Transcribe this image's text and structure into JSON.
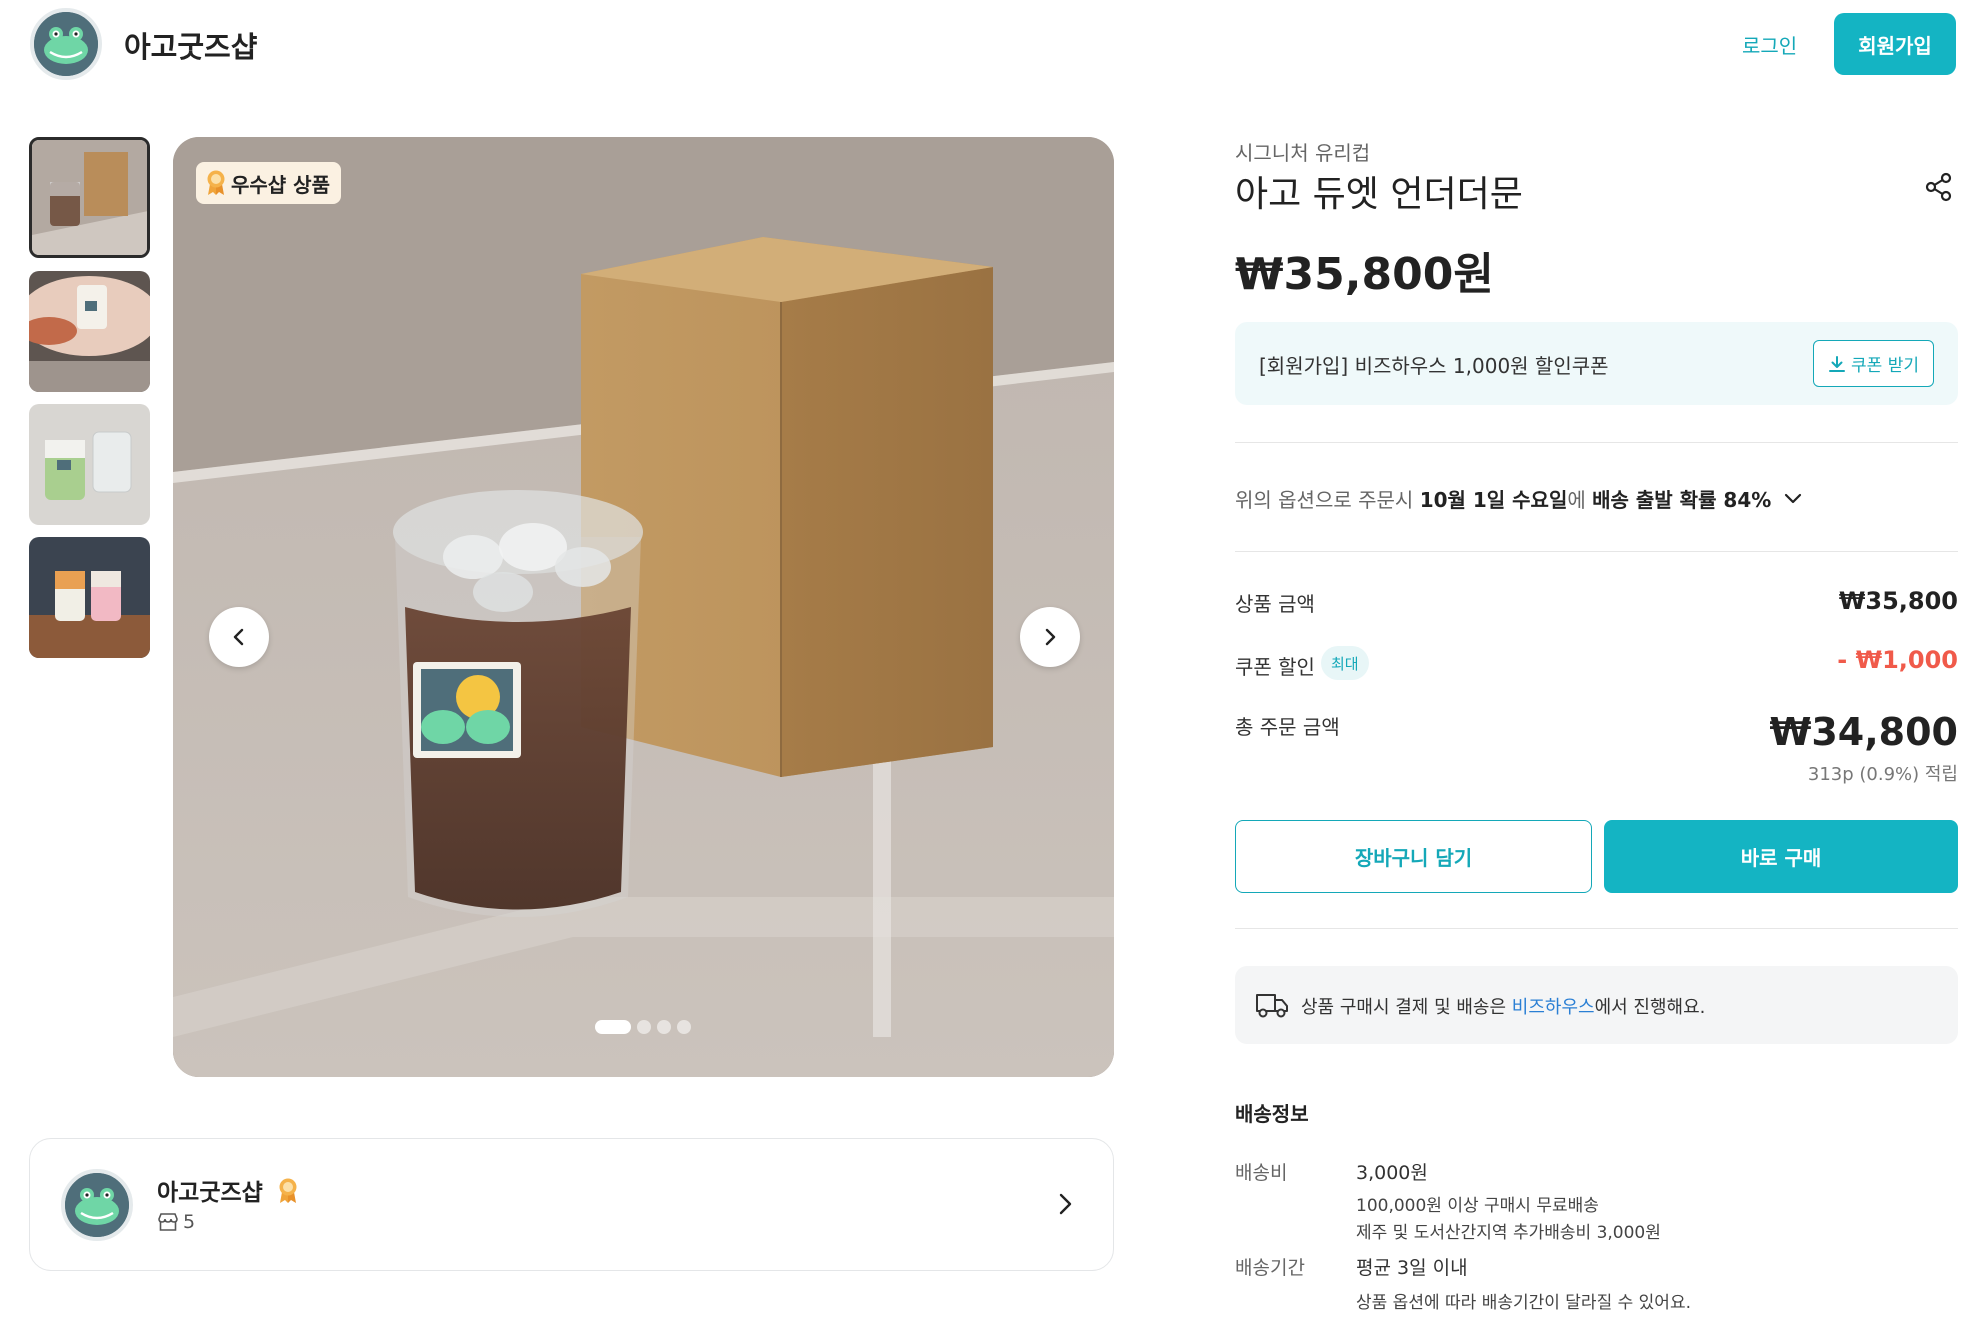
{
  "header": {
    "brand": "아고굿즈샵",
    "login": "로그인",
    "signup": "회원가입"
  },
  "gallery": {
    "thumbnails": [
      {
        "name": "thumb-1",
        "active": true
      },
      {
        "name": "thumb-2",
        "active": false
      },
      {
        "name": "thumb-3",
        "active": false
      },
      {
        "name": "thumb-4",
        "active": false
      }
    ],
    "badge": "우수샵 상품",
    "slide_count": 4,
    "active_slide": 1
  },
  "shop": {
    "name": "아고굿즈샵",
    "product_count": "5"
  },
  "product": {
    "category": "시그니처 유리컵",
    "title": "아고 듀엣 언더더문",
    "price": "₩35,800원"
  },
  "coupon": {
    "text": "[회원가입] 비즈하우스 1,000원 할인쿠폰",
    "button": "쿠폰 받기"
  },
  "shipping_probability": {
    "prefix": "위의 옵션으로 주문시 ",
    "date": "10월 1일 수요일",
    "middle": "에 ",
    "prob": "배송 출발 확률 84%"
  },
  "summary": {
    "product_amount_label": "상품 금액",
    "product_amount": "₩35,800",
    "coupon_label": "쿠폰 할인",
    "coupon_badge": "최대",
    "coupon_amount": "- ₩1,000",
    "total_label": "총 주문 금액",
    "total": "₩34,800",
    "points": "313p (0.9%) 적립"
  },
  "actions": {
    "cart": "장바구니 담기",
    "buy": "바로 구매"
  },
  "notice": {
    "before": "상품 구매시 결제 및 배송은 ",
    "link": "비즈하우스",
    "after": "에서 진행해요."
  },
  "delivery": {
    "title": "배송정보",
    "fee_label": "배송비",
    "fee": "3,000원",
    "fee_note1": "100,000원 이상 구매시 무료배송",
    "fee_note2": "제주 및 도서산간지역 추가배송비 3,000원",
    "period_label": "배송기간",
    "period": "평균 3일 이내",
    "period_note": "상품 옵션에 따라 배송기간이 달라질 수 있어요."
  },
  "colors": {
    "accent": "#14b4c3",
    "link": "#2a7fd4",
    "discount": "#f05a4a"
  }
}
